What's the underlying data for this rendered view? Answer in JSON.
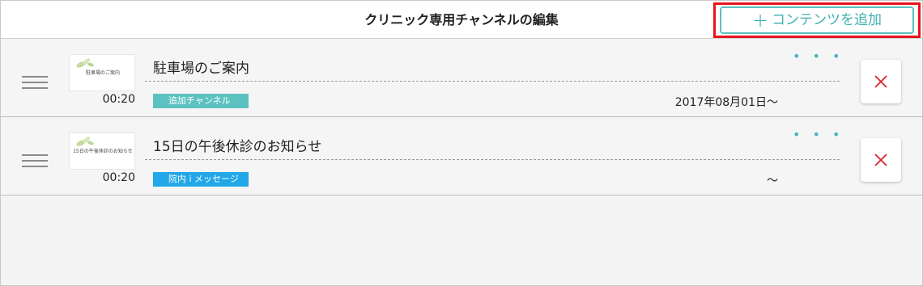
{
  "header": {
    "title": "クリニック専用チャンネルの編集",
    "add_button_label": "コンテンツを追加",
    "add_button_icon": "plus-icon"
  },
  "items": [
    {
      "thumbnail_text": "駐車場のご案内",
      "duration": "00:20",
      "title": "駐車場のご案内",
      "menu_icon": "more-dots-icon",
      "tag": "追加チャンネル",
      "tag_color": "#5cc2c0",
      "date": "2017年08月01日〜",
      "delete_icon": "close-icon"
    },
    {
      "thumbnail_text": "15日の午後休診のお知らせ",
      "duration": "00:20",
      "title": "15日の午後休診のお知らせ",
      "menu_icon": "more-dots-icon",
      "tag": "院内 i メッセージ",
      "tag_color": "#22a7e8",
      "date": "〜",
      "delete_icon": "close-icon"
    }
  ],
  "colors": {
    "accent": "#45b5c0",
    "highlight": "#e8141b",
    "delete": "#d9232b"
  }
}
